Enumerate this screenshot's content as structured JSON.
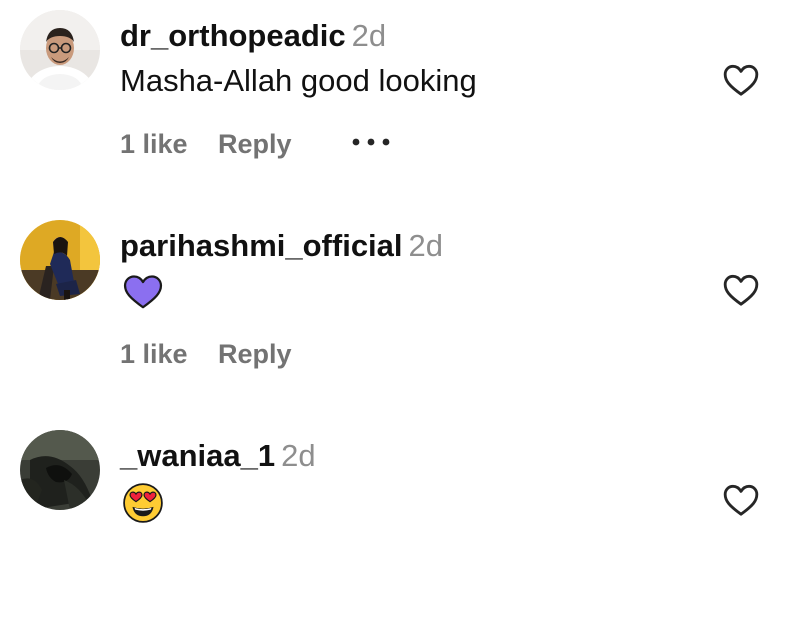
{
  "comments": [
    {
      "username": "dr_orthopeadic",
      "timestamp": "2d",
      "text": "Masha-Allah good looking",
      "like_count": "1 like",
      "reply_label": "Reply",
      "emoji": "",
      "has_more_menu": true
    },
    {
      "username": "parihashmi_official",
      "timestamp": "2d",
      "text": "",
      "emoji": "purple-heart",
      "like_count": "1 like",
      "reply_label": "Reply",
      "has_more_menu": false
    },
    {
      "username": "_waniaa_1",
      "timestamp": "2d",
      "text": "",
      "emoji": "heart-eyes",
      "has_more_menu": false
    }
  ],
  "colors": {
    "text_primary": "#111111",
    "text_secondary": "#737373",
    "timestamp": "#8e8e8e",
    "purple_heart": "#8b6ff0",
    "emoji_yellow": "#ffcc33",
    "emoji_heart_red": "#f0213c"
  },
  "icons": {
    "like": "heart-outline-icon",
    "more": "ellipsis-icon"
  }
}
